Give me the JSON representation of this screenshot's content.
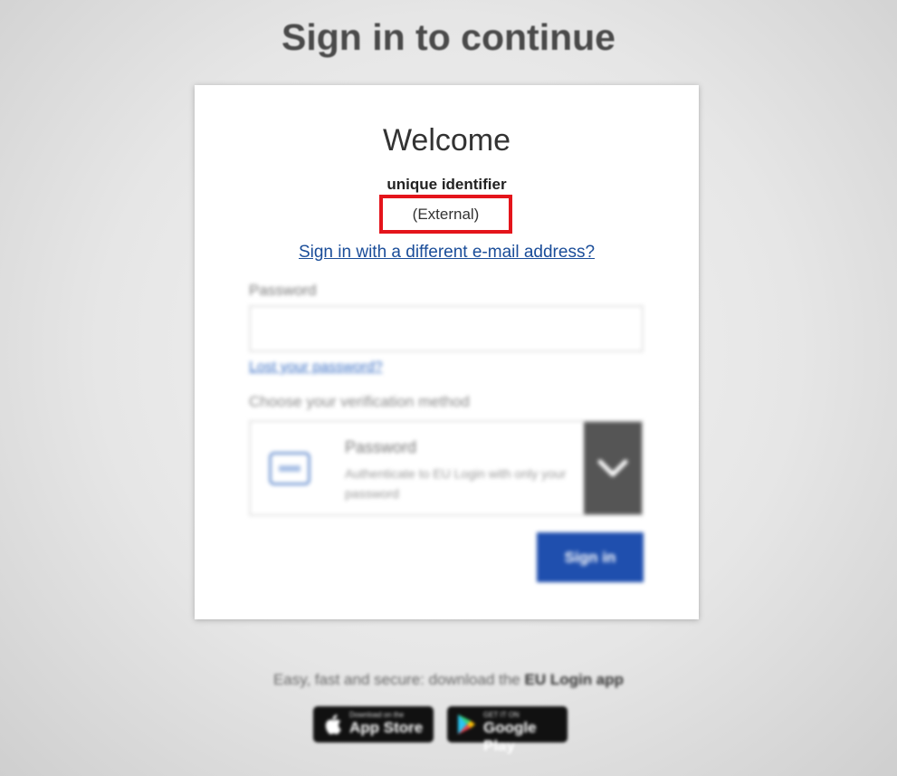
{
  "page": {
    "title": "Sign in to continue"
  },
  "card": {
    "welcome": "Welcome",
    "identifier": "unique identifier",
    "account_type": "(External)",
    "different_email_link": "Sign in with a different e-mail address?",
    "password_label": "Password",
    "password_value": "",
    "lost_password_link": "Lost your password?",
    "verification_label": "Choose your verification method",
    "method": {
      "title": "Password",
      "description": "Authenticate to EU Login with only your password",
      "icon": "password-card-icon"
    },
    "sign_in_button": "Sign in"
  },
  "footer": {
    "promo_text": "Easy, fast and secure: download the ",
    "promo_app": "EU Login app",
    "app_store": {
      "small": "Download on the",
      "big": "App Store",
      "icon": "apple-icon"
    },
    "google_play": {
      "small": "GET IT ON",
      "big": "Google Play",
      "icon": "google-play-icon"
    }
  },
  "colors": {
    "highlight_border": "#e4141b",
    "link": "#1a4d99",
    "primary_button": "#1f4fae"
  }
}
